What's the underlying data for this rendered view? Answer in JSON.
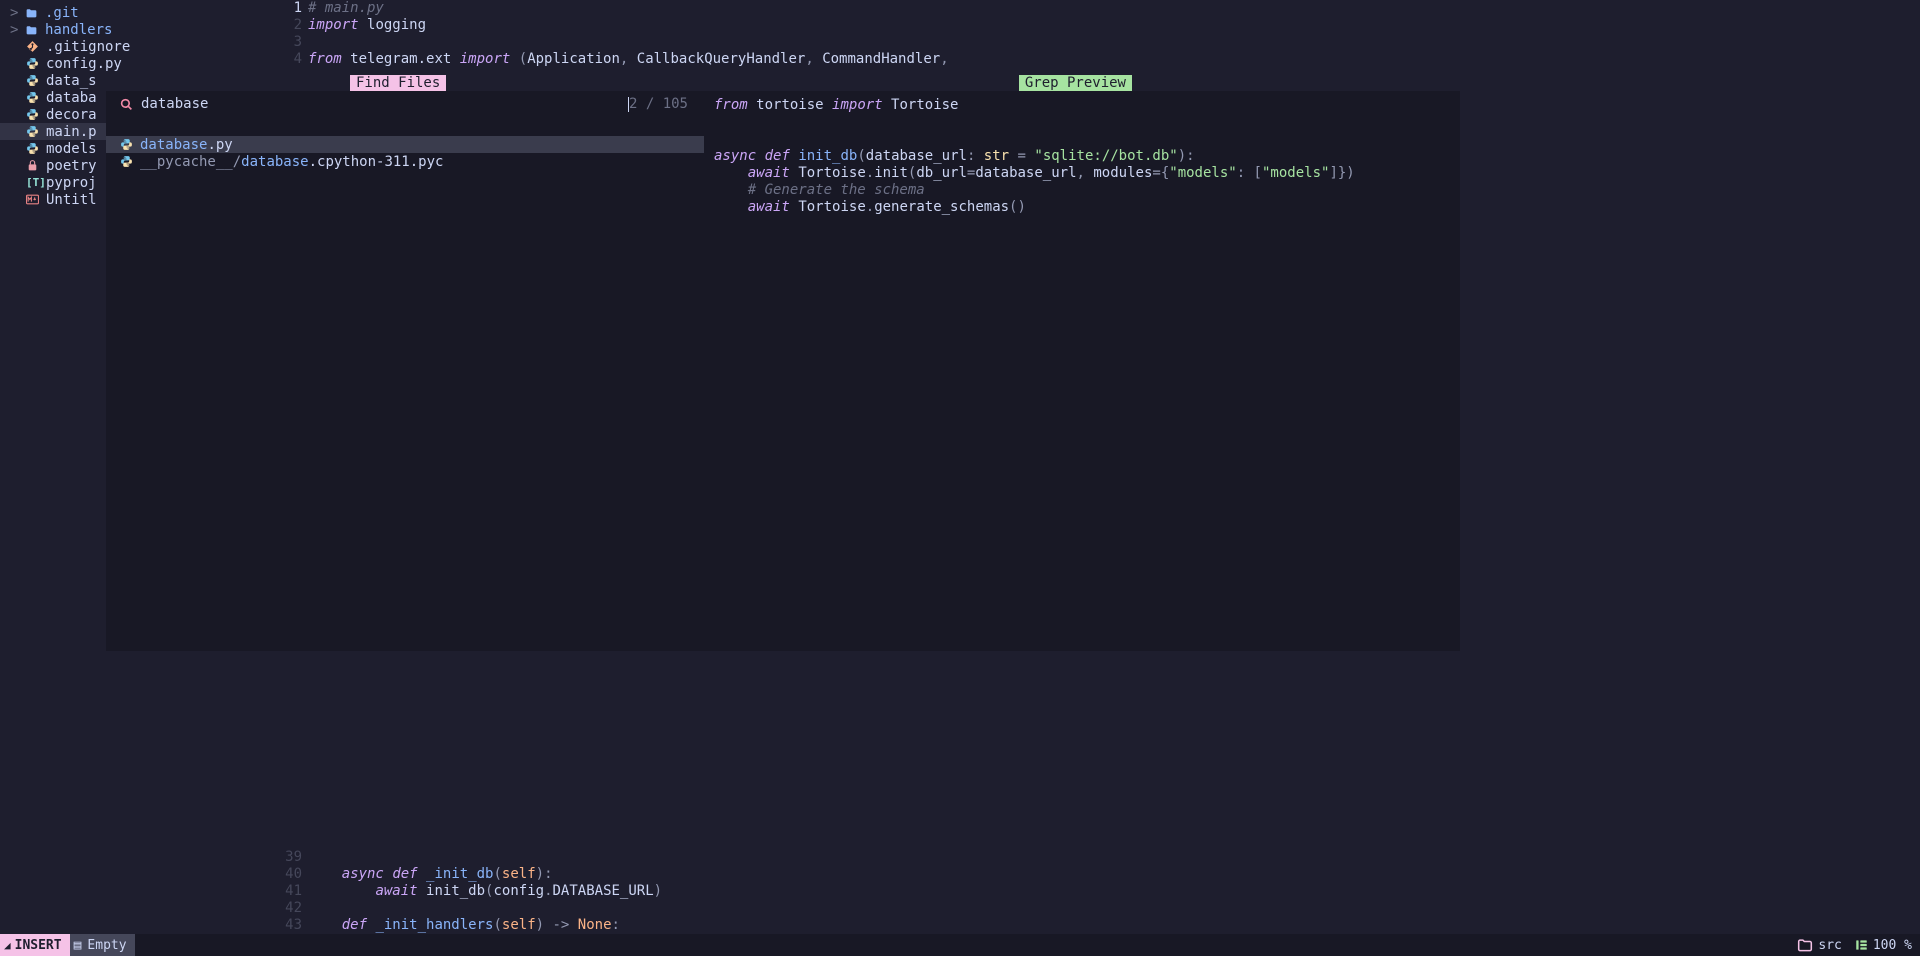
{
  "file_tree": [
    {
      "kind": "folder",
      "expand": ">",
      "name": ".git"
    },
    {
      "kind": "folder",
      "expand": ">",
      "name": "handlers"
    },
    {
      "kind": "git",
      "name": ".gitignore"
    },
    {
      "kind": "python",
      "name": "config.py"
    },
    {
      "kind": "python",
      "name": "data_s"
    },
    {
      "kind": "python",
      "name": "databa"
    },
    {
      "kind": "python",
      "name": "decora"
    },
    {
      "kind": "python",
      "name": "main.p",
      "selected": true
    },
    {
      "kind": "python",
      "name": "models"
    },
    {
      "kind": "lock",
      "name": "poetry"
    },
    {
      "kind": "toml",
      "name": "pyproj"
    },
    {
      "kind": "md",
      "name": "Untitl"
    }
  ],
  "editor_top": {
    "gutter": [
      "1",
      "2",
      "3",
      "4"
    ],
    "lines": [
      [
        {
          "t": "# main.py",
          "c": "comment"
        }
      ],
      [
        {
          "t": "import",
          "c": "import-kw"
        },
        {
          "t": " ",
          "c": "ident"
        },
        {
          "t": "logging",
          "c": "ident"
        }
      ],
      [],
      [
        {
          "t": "from",
          "c": "import-kw"
        },
        {
          "t": " ",
          "c": "ident"
        },
        {
          "t": "telegram.ext",
          "c": "ident"
        },
        {
          "t": " ",
          "c": "ident"
        },
        {
          "t": "import",
          "c": "import-kw"
        },
        {
          "t": " (",
          "c": "punct"
        },
        {
          "t": "Application",
          "c": "ident"
        },
        {
          "t": ", ",
          "c": "punct"
        },
        {
          "t": "CallbackQueryHandler",
          "c": "ident"
        },
        {
          "t": ", ",
          "c": "punct"
        },
        {
          "t": "CommandHandler",
          "c": "ident"
        },
        {
          "t": ",",
          "c": "punct"
        }
      ]
    ]
  },
  "editor_bottom": {
    "gutter": [
      "39",
      "40",
      "41",
      "42",
      "43"
    ],
    "lines": [
      [],
      [
        {
          "t": "    ",
          "c": "ident"
        },
        {
          "t": "async",
          "c": "kw"
        },
        {
          "t": " ",
          "c": "ident"
        },
        {
          "t": "def",
          "c": "kw"
        },
        {
          "t": " ",
          "c": "ident"
        },
        {
          "t": "_init_db",
          "c": "fn"
        },
        {
          "t": "(",
          "c": "punct"
        },
        {
          "t": "self",
          "c": "builtin"
        },
        {
          "t": "):",
          "c": "punct"
        }
      ],
      [
        {
          "t": "        ",
          "c": "ident"
        },
        {
          "t": "await",
          "c": "kw"
        },
        {
          "t": " ",
          "c": "ident"
        },
        {
          "t": "init_db",
          "c": "ident"
        },
        {
          "t": "(",
          "c": "punct"
        },
        {
          "t": "config",
          "c": "ident"
        },
        {
          "t": ".",
          "c": "punct"
        },
        {
          "t": "DATABASE_URL",
          "c": "ident"
        },
        {
          "t": ")",
          "c": "punct"
        }
      ],
      [],
      [
        {
          "t": "    ",
          "c": "ident"
        },
        {
          "t": "def",
          "c": "kw"
        },
        {
          "t": " ",
          "c": "ident"
        },
        {
          "t": "_init_handlers",
          "c": "fn"
        },
        {
          "t": "(",
          "c": "punct"
        },
        {
          "t": "self",
          "c": "builtin"
        },
        {
          "t": ") -> ",
          "c": "punct"
        },
        {
          "t": "None",
          "c": "const"
        },
        {
          "t": ":",
          "c": "punct"
        }
      ]
    ]
  },
  "find": {
    "title": "Find Files",
    "grep_title": "Grep Preview",
    "query": "database",
    "counter": "2 / 105",
    "results": [
      {
        "icon": "python",
        "pre": "",
        "match": "database",
        "post": ".py",
        "selected": true
      },
      {
        "icon": "python",
        "pre": "__pycache__/",
        "match": "database",
        "post": ".cpython-311.pyc"
      }
    ],
    "preview": [
      [
        {
          "t": "from",
          "c": "import-kw"
        },
        {
          "t": " ",
          "c": "ident"
        },
        {
          "t": "tortoise",
          "c": "ident"
        },
        {
          "t": " ",
          "c": "ident"
        },
        {
          "t": "import",
          "c": "import-kw"
        },
        {
          "t": " ",
          "c": "ident"
        },
        {
          "t": "Tortoise",
          "c": "ident"
        }
      ],
      [],
      [],
      [
        {
          "t": "async",
          "c": "kw"
        },
        {
          "t": " ",
          "c": "ident"
        },
        {
          "t": "def",
          "c": "kw"
        },
        {
          "t": " ",
          "c": "ident"
        },
        {
          "t": "init_db",
          "c": "fn"
        },
        {
          "t": "(",
          "c": "punct"
        },
        {
          "t": "database_url",
          "c": "param"
        },
        {
          "t": ": ",
          "c": "punct"
        },
        {
          "t": "str",
          "c": "type"
        },
        {
          "t": " = ",
          "c": "punct"
        },
        {
          "t": "\"sqlite://bot.db\"",
          "c": "str"
        },
        {
          "t": "):",
          "c": "punct"
        }
      ],
      [
        {
          "t": "    ",
          "c": "ident"
        },
        {
          "t": "await",
          "c": "kw"
        },
        {
          "t": " ",
          "c": "ident"
        },
        {
          "t": "Tortoise",
          "c": "ident"
        },
        {
          "t": ".",
          "c": "punct"
        },
        {
          "t": "init",
          "c": "ident"
        },
        {
          "t": "(",
          "c": "punct"
        },
        {
          "t": "db_url",
          "c": "param"
        },
        {
          "t": "=",
          "c": "punct"
        },
        {
          "t": "database_url",
          "c": "ident"
        },
        {
          "t": ", ",
          "c": "punct"
        },
        {
          "t": "modules",
          "c": "param"
        },
        {
          "t": "=",
          "c": "punct"
        },
        {
          "t": "{",
          "c": "punct"
        },
        {
          "t": "\"models\"",
          "c": "str"
        },
        {
          "t": ": [",
          "c": "punct"
        },
        {
          "t": "\"models\"",
          "c": "str"
        },
        {
          "t": "]})",
          "c": "punct"
        }
      ],
      [
        {
          "t": "    ",
          "c": "ident"
        },
        {
          "t": "# Generate the schema",
          "c": "comment"
        }
      ],
      [
        {
          "t": "    ",
          "c": "ident"
        },
        {
          "t": "await",
          "c": "kw"
        },
        {
          "t": " ",
          "c": "ident"
        },
        {
          "t": "Tortoise",
          "c": "ident"
        },
        {
          "t": ".",
          "c": "punct"
        },
        {
          "t": "generate_schemas",
          "c": "ident"
        },
        {
          "t": "()",
          "c": "punct"
        }
      ]
    ]
  },
  "statusbar": {
    "mode": "INSERT",
    "empty_label": "Empty",
    "folder": "src",
    "percent": "100 %"
  }
}
